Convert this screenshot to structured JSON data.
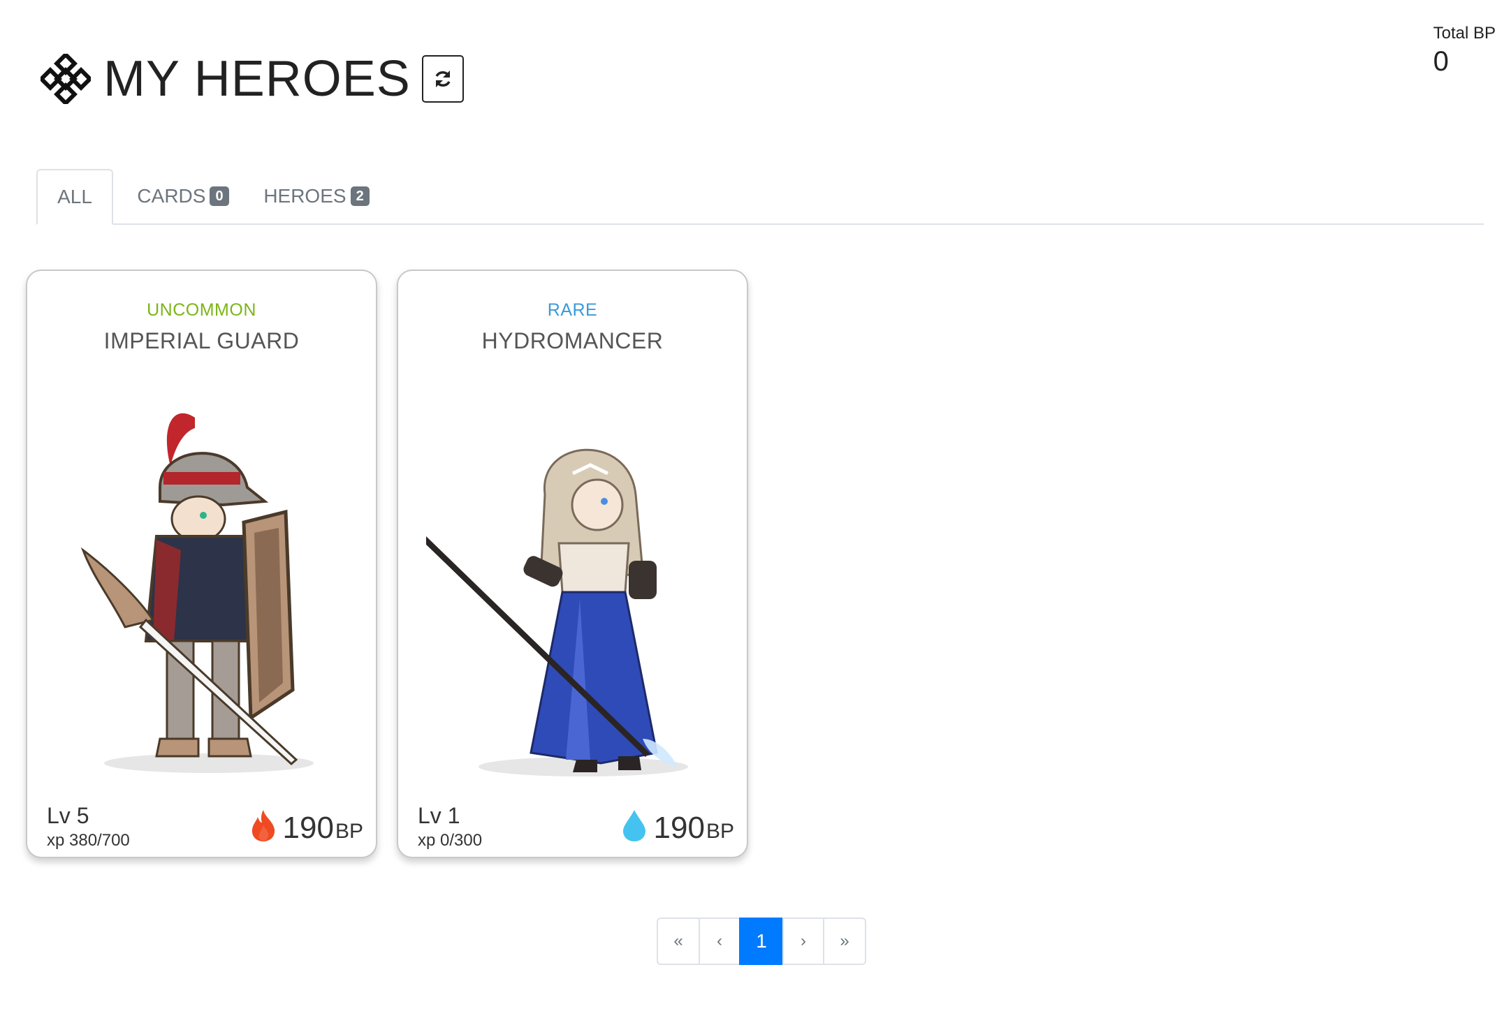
{
  "header": {
    "title": "MY HEROES",
    "refresh_icon": "refresh-icon",
    "logo_icon": "knot-logo-icon"
  },
  "total": {
    "label": "Total BP",
    "value": "0"
  },
  "tabs": [
    {
      "label": "ALL",
      "active": true
    },
    {
      "label": "CARDS",
      "badge": "0",
      "active": false
    },
    {
      "label": "HEROES",
      "badge": "2",
      "active": false
    }
  ],
  "cards": [
    {
      "rarity": "UNCOMMON",
      "rarity_color": "#7cb518",
      "name": "IMPERIAL GUARD",
      "level": "Lv 5",
      "xp": "xp 380/700",
      "bp_value": "190",
      "bp_unit": "BP",
      "element_icon": "fire-icon",
      "element_color": "#f04a23"
    },
    {
      "rarity": "RARE",
      "rarity_color": "#3a9bd8",
      "name": "HYDROMANCER",
      "level": "Lv 1",
      "xp": "xp 0/300",
      "bp_value": "190",
      "bp_unit": "BP",
      "element_icon": "water-drop-icon",
      "element_color": "#45c3f0"
    }
  ],
  "pagination": {
    "first": "«",
    "prev": "‹",
    "current": "1",
    "next": "›",
    "last": "»"
  }
}
